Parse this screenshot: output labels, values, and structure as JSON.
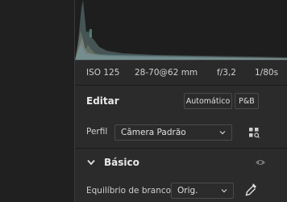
{
  "exif": {
    "iso": "ISO 125",
    "lens": "28-70@62 mm",
    "aperture": "f/3,2",
    "shutter": "1/80s"
  },
  "editar": {
    "title": "Editar",
    "auto_label": "Automático",
    "bw_label": "P&B"
  },
  "perfil": {
    "label": "Perfil",
    "value": "Câmera Padrão",
    "browse_icon": "grid-browse-icon"
  },
  "basico": {
    "title": "Básico",
    "visibility_icon": "eye-icon",
    "wb_label": "Equilíbrio de branco",
    "wb_value": "Orig.",
    "eyedropper_icon": "eyedropper-icon"
  }
}
